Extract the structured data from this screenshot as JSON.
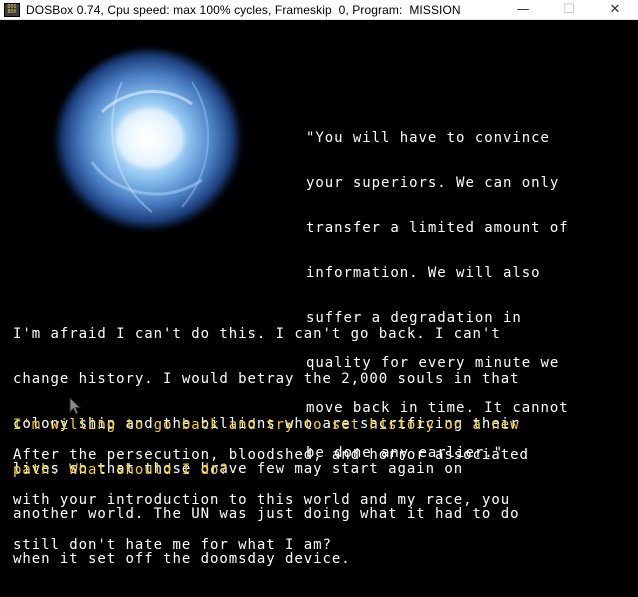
{
  "window": {
    "title": "DOSBox 0.74, Cpu speed: max 100% cycles, Frameskip  0, Program:  MISSION",
    "icon_label_top": "DOS",
    "icon_label_bottom": "BOX",
    "minimize_glyph": "—",
    "maximize_glyph": "☐",
    "close_glyph": "✕"
  },
  "colors": {
    "background": "#000000",
    "dialog_text": "#ffffff",
    "choice_text": "#f6cf2a",
    "orb_core": "#dff4ff",
    "orb_mid": "#6fa6e0",
    "orb_edge": "#1a3c7a"
  },
  "dialog": {
    "quote_lines": [
      "\"You will have to convince",
      "your superiors. We can only",
      "transfer a limited amount of",
      "information. We will also",
      "suffer a degradation in",
      "quality for every minute we",
      "move back in time. It cannot",
      "be done any earlier.\""
    ],
    "paragraph_lines": [
      "I'm afraid I can't do this. I can't go back. I can't",
      "change history. I would betray the 2,000 souls in that",
      "colony ship and the billions who are sacrificing their",
      "lives so that those brave few may start again on",
      "another world. The UN was just doing what it had to do",
      "when it set off the doomsday device."
    ],
    "choice_lines": [
      "I'm willing to go back and try to set history on a new",
      "path. What should I do?"
    ],
    "reply_lines": [
      "After the persecution, bloodshed, and horror associated",
      "with your introduction to this world and my race, you",
      "still don't hate me for what I am?"
    ]
  },
  "icons": {
    "orb": "glowing-energy-orb-icon",
    "cursor": "mouse-pointer-icon"
  }
}
